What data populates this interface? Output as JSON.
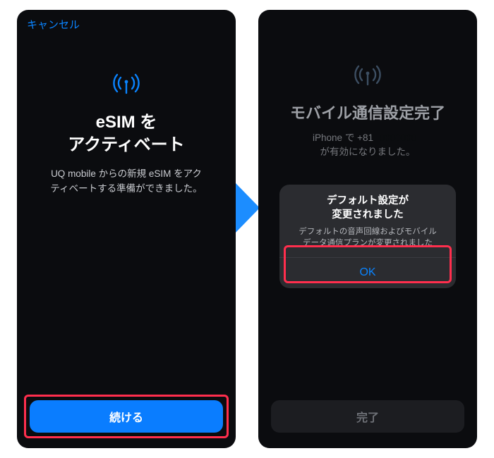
{
  "left": {
    "cancel": "キャンセル",
    "title_line1": "eSIM を",
    "title_line2": "アクティベート",
    "desc_line1": "UQ mobile からの新規 eSIM をアク",
    "desc_line2": "ティベートする準備ができました。",
    "continue": "続ける"
  },
  "right": {
    "title": "モバイル通信設定完了",
    "sub_line1_pre": "iPhone で +81",
    "sub_line2": "が有効になりました。",
    "alert_title_line1": "デフォルト設定が",
    "alert_title_line2": "変更されました",
    "alert_msg_line1": "デフォルトの音声回線およびモバイル",
    "alert_msg_line2": "データ通信プランが変更されました",
    "ok": "OK",
    "done": "完了"
  },
  "colors": {
    "accent": "#0a84ff",
    "highlight": "#ff2e4d"
  }
}
